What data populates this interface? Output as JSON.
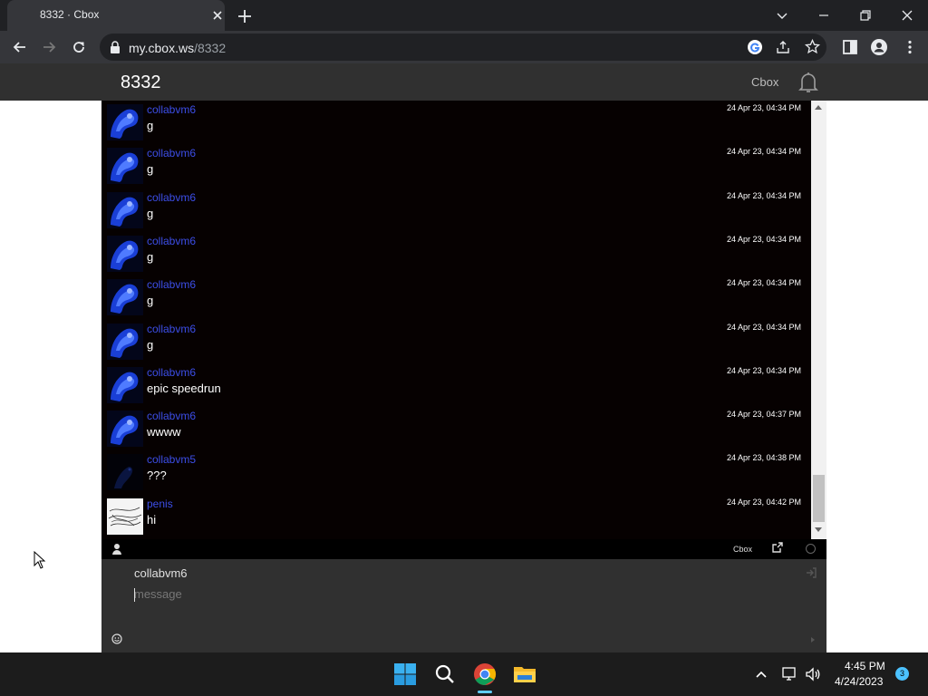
{
  "browser": {
    "tab_title": "8332 · Cbox",
    "url_host": "my.cbox.ws",
    "url_path": "/8332"
  },
  "site": {
    "title": "8332",
    "link": "Cbox"
  },
  "messages": [
    {
      "user": "collabvm6",
      "text": "g",
      "time": "24 Apr 23, 04:34 PM",
      "avatar": "blue"
    },
    {
      "user": "collabvm6",
      "text": "g",
      "time": "24 Apr 23, 04:34 PM",
      "avatar": "blue"
    },
    {
      "user": "collabvm6",
      "text": "g",
      "time": "24 Apr 23, 04:34 PM",
      "avatar": "blue"
    },
    {
      "user": "collabvm6",
      "text": "g",
      "time": "24 Apr 23, 04:34 PM",
      "avatar": "blue"
    },
    {
      "user": "collabvm6",
      "text": "g",
      "time": "24 Apr 23, 04:34 PM",
      "avatar": "blue"
    },
    {
      "user": "collabvm6",
      "text": "g",
      "time": "24 Apr 23, 04:34 PM",
      "avatar": "blue"
    },
    {
      "user": "collabvm6",
      "text": "epic speedrun",
      "time": "24 Apr 23, 04:34 PM",
      "avatar": "blue"
    },
    {
      "user": "collabvm6",
      "text": "wwww",
      "time": "24 Apr 23, 04:37 PM",
      "avatar": "blue"
    },
    {
      "user": "collabvm5",
      "text": "???",
      "time": "24 Apr 23, 04:38 PM",
      "avatar": "dark"
    },
    {
      "user": "penis",
      "text": "hi",
      "time": "24 Apr 23, 04:42 PM",
      "avatar": "sketch"
    }
  ],
  "chat": {
    "footer_label": "Cbox",
    "name_value": "collabvm6",
    "message_placeholder": "message"
  },
  "taskbar": {
    "time": "4:45 PM",
    "date": "4/24/2023",
    "notification_count": "3"
  },
  "colors": {
    "username": "#3c4ee8",
    "chat_bg": "#060101",
    "header_bg": "#303030"
  }
}
